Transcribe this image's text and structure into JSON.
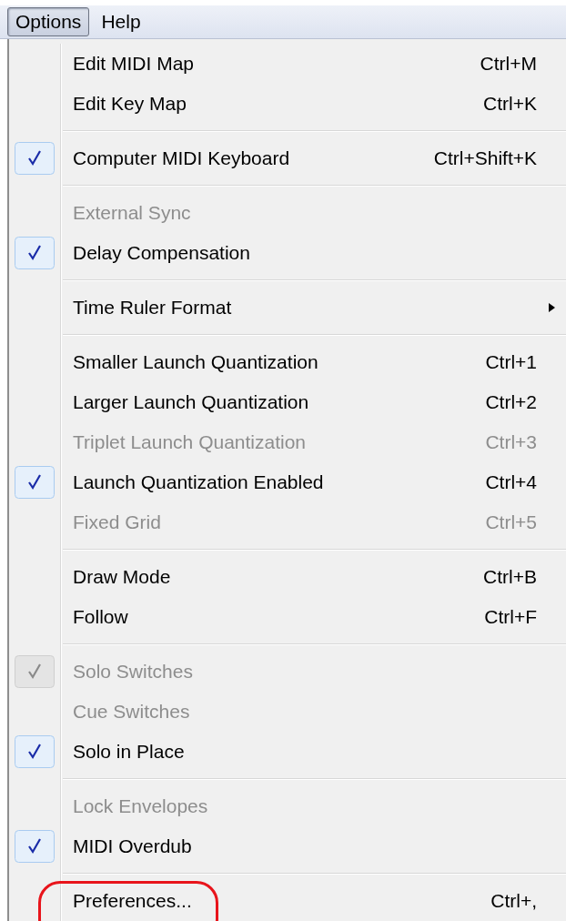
{
  "menubar": [
    {
      "label": "Options",
      "selected": true
    },
    {
      "label": "Help",
      "selected": false
    }
  ],
  "menu_groups": [
    [
      {
        "label": "Edit MIDI Map",
        "shortcut": "Ctrl+M",
        "checked": false,
        "disabled": false
      },
      {
        "label": "Edit Key Map",
        "shortcut": "Ctrl+K",
        "checked": false,
        "disabled": false
      }
    ],
    [
      {
        "label": "Computer MIDI Keyboard",
        "shortcut": "Ctrl+Shift+K",
        "checked": true,
        "disabled": false
      }
    ],
    [
      {
        "label": "External Sync",
        "checked": false,
        "disabled": true
      },
      {
        "label": "Delay Compensation",
        "checked": true,
        "disabled": false
      }
    ],
    [
      {
        "label": "Time Ruler Format",
        "checked": false,
        "disabled": false,
        "submenu": true
      }
    ],
    [
      {
        "label": "Smaller Launch Quantization",
        "shortcut": "Ctrl+1",
        "checked": false,
        "disabled": false
      },
      {
        "label": "Larger Launch Quantization",
        "shortcut": "Ctrl+2",
        "checked": false,
        "disabled": false
      },
      {
        "label": "Triplet Launch Quantization",
        "shortcut": "Ctrl+3",
        "checked": false,
        "disabled": true
      },
      {
        "label": "Launch Quantization Enabled",
        "shortcut": "Ctrl+4",
        "checked": true,
        "disabled": false
      },
      {
        "label": "Fixed Grid",
        "shortcut": "Ctrl+5",
        "checked": false,
        "disabled": true
      }
    ],
    [
      {
        "label": "Draw Mode",
        "shortcut": "Ctrl+B",
        "checked": false,
        "disabled": false
      },
      {
        "label": "Follow",
        "shortcut": "Ctrl+F",
        "checked": false,
        "disabled": false
      }
    ],
    [
      {
        "label": "Solo Switches",
        "checked": true,
        "disabled": true
      },
      {
        "label": "Cue Switches",
        "checked": false,
        "disabled": true
      },
      {
        "label": "Solo in Place",
        "checked": true,
        "disabled": false
      }
    ],
    [
      {
        "label": "Lock Envelopes",
        "checked": false,
        "disabled": true
      },
      {
        "label": "MIDI Overdub",
        "checked": true,
        "disabled": false
      }
    ],
    [
      {
        "label": "Preferences...",
        "shortcut": "Ctrl+,",
        "checked": false,
        "disabled": false,
        "circled": true
      }
    ]
  ]
}
